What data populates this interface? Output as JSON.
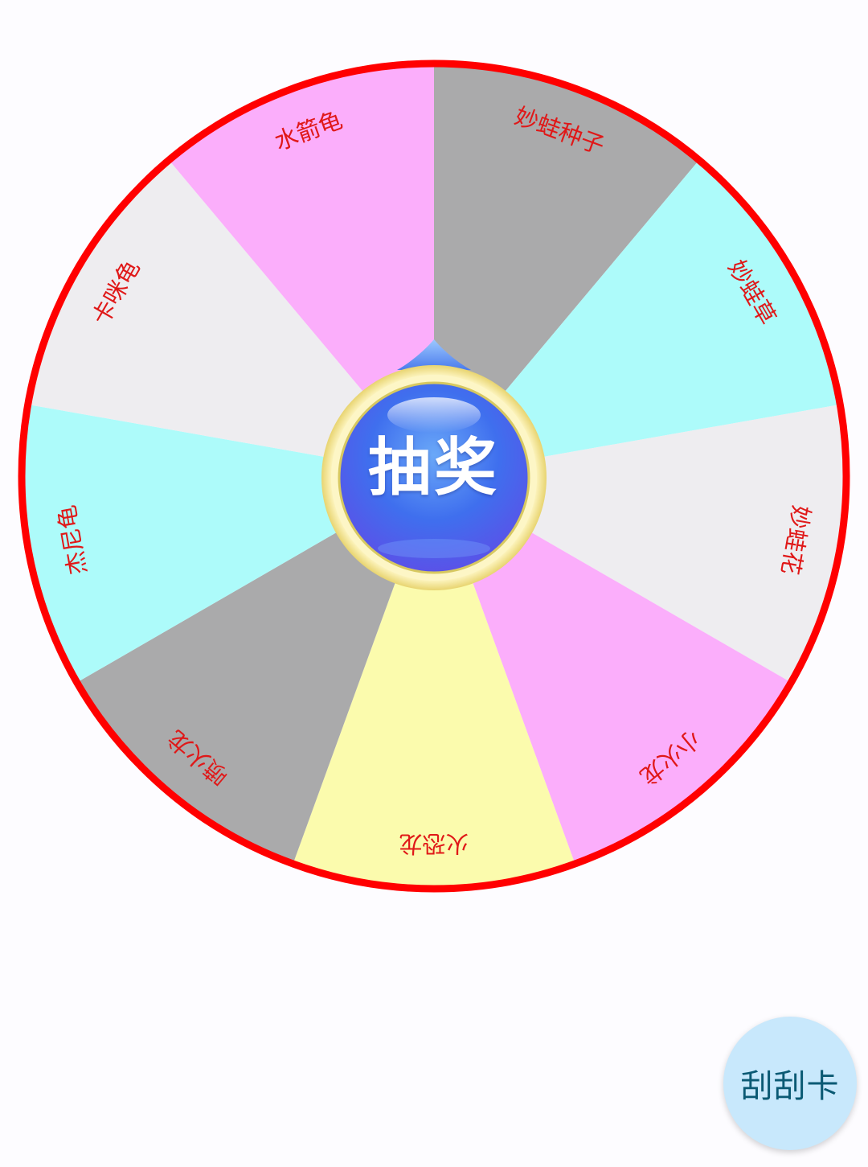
{
  "wheel": {
    "border_color": "#ff0000",
    "label_color": "#e01818",
    "segments": [
      {
        "label": "妙蛙种子",
        "color": "#aaaaab"
      },
      {
        "label": "妙蛙草",
        "color": "#adfbfa"
      },
      {
        "label": "妙蛙花",
        "color": "#eeedf0"
      },
      {
        "label": "小火龙",
        "color": "#fbaefb"
      },
      {
        "label": "火恐龙",
        "color": "#fbfbad"
      },
      {
        "label": "喷火龙",
        "color": "#aaaaab"
      },
      {
        "label": "杰尼龟",
        "color": "#adfbfa"
      },
      {
        "label": "卡咪龟",
        "color": "#eeedf0"
      },
      {
        "label": "水箭龟",
        "color": "#fbaefb"
      }
    ]
  },
  "draw_button": {
    "label": "抽奖",
    "icon": "pointer-knob-icon"
  },
  "fab": {
    "label": "刮刮卡",
    "color": "#c8e8fc"
  }
}
